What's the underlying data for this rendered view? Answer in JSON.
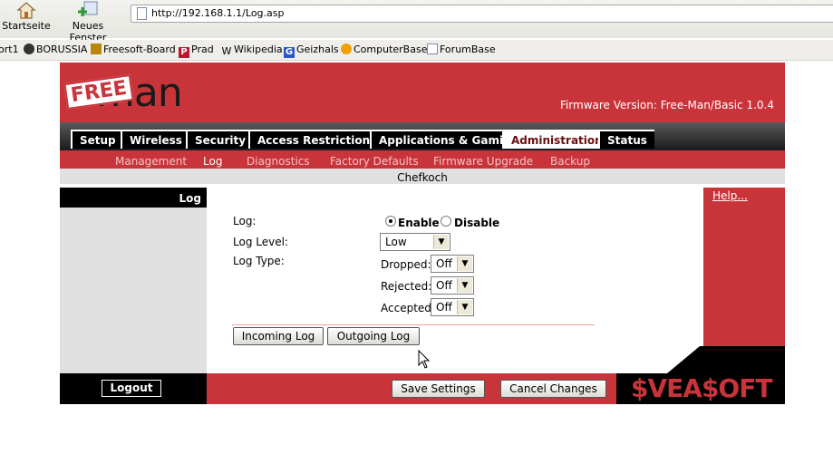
{
  "browser": {
    "toolbar": {
      "start_label": "Startseite",
      "new_window_label": "Neues Fenster"
    },
    "url": "http://192.168.1.1/Log.asp",
    "bookmarks": [
      "ort1",
      "BORUSSIA",
      "Freesoft-Board",
      "Prad",
      "Wikipedia",
      "Geizhals",
      "ComputerBase",
      "ForumBase"
    ]
  },
  "header": {
    "logo_badge": "FREE",
    "logo_text": "man",
    "firmware": "Firmware Version: Free-Man/Basic 1.0.4"
  },
  "tabs": [
    "Setup",
    "Wireless",
    "Security",
    "Access Restrictions",
    "Applications & Gaming",
    "Administration",
    "Status"
  ],
  "subnav": [
    "Management",
    "Log",
    "Diagnostics",
    "Factory Defaults",
    "Firmware Upgrade",
    "Backup"
  ],
  "profile_name": "Chefkoch",
  "section_title": "Log",
  "form": {
    "log_label": "Log:",
    "enable_label": "Enable",
    "disable_label": "Disable",
    "log_enabled": true,
    "level_label": "Log Level:",
    "level_value": "Low",
    "type_label": "Log Type:",
    "dropped_label": "Dropped:",
    "dropped_value": "Off",
    "rejected_label": "Rejected:",
    "rejected_value": "Off",
    "accepted_label": "Accepted:",
    "accepted_value": "Off",
    "incoming_btn": "Incoming Log",
    "outgoing_btn": "Outgoing Log"
  },
  "help_link": "Help...",
  "footer": {
    "logout": "Logout",
    "save": "Save Settings",
    "cancel": "Cancel Changes",
    "brand": "$VEA$OFT"
  },
  "colors": {
    "brand_red": "#c8343a",
    "dark": "#000000",
    "panel_grey": "#e0e0e0"
  }
}
